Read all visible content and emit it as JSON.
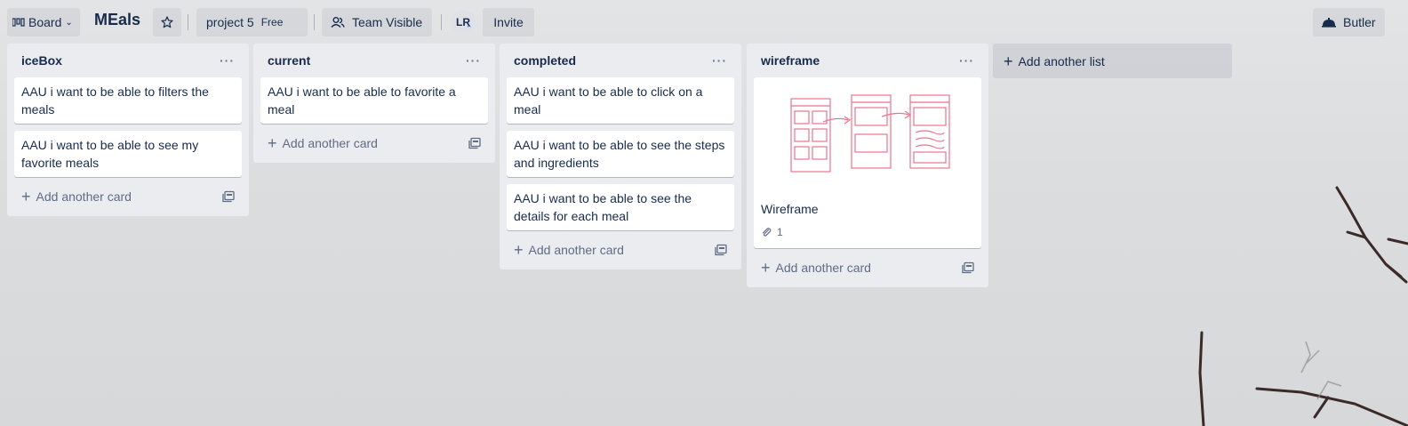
{
  "header": {
    "board_switch_label": "Board",
    "board_title": "MEals",
    "project_label": "project 5",
    "free_badge": "Free",
    "visibility_label": "Team Visible",
    "avatar_initials": "LR",
    "invite_label": "Invite",
    "butler_label": "Butler"
  },
  "lists": [
    {
      "title": "iceBox",
      "cards": [
        "AAU i want to be able to filters the meals",
        "AAU i want to be able to see my favorite meals"
      ],
      "add_label": "Add another card"
    },
    {
      "title": "current",
      "cards": [
        "AAU i want to be able to favorite a meal"
      ],
      "add_label": "Add another card"
    },
    {
      "title": "completed",
      "cards": [
        "AAU i want to be able to click on a meal",
        "AAU i want to be able to see the steps and ingredients",
        "AAU i want to be able to see the details for each meal"
      ],
      "add_label": "Add another card"
    },
    {
      "title": "wireframe",
      "cards": [],
      "cover_card": {
        "title": "Wireframe",
        "attachments": "1"
      },
      "add_label": "Add another card"
    }
  ],
  "add_list_label": "Add another list",
  "colors": {
    "list_bg": "#ebecf0",
    "wireframe_ink": "#e8758f"
  }
}
